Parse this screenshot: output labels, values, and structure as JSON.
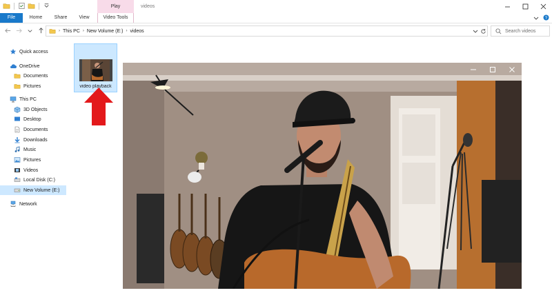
{
  "titlebar": {
    "context_tab": "Play",
    "window_title": "videos"
  },
  "ribbon": {
    "tabs": [
      "File",
      "Home",
      "Share",
      "View",
      "Video Tools"
    ]
  },
  "address": {
    "crumbs": [
      "This PC",
      "New Volume (E:)",
      "videos"
    ],
    "search_placeholder": "Search videos"
  },
  "navpane": {
    "items": [
      {
        "label": "Quick access",
        "icon": "star-icon"
      },
      {
        "label": "OneDrive",
        "icon": "cloud-icon"
      },
      {
        "label": "Documents",
        "icon": "folder-icon"
      },
      {
        "label": "Pictures",
        "icon": "folder-icon"
      },
      {
        "label": "This PC",
        "icon": "computer-icon"
      },
      {
        "label": "3D Objects",
        "icon": "cube-icon"
      },
      {
        "label": "Desktop",
        "icon": "desktop-icon"
      },
      {
        "label": "Documents",
        "icon": "documents-icon"
      },
      {
        "label": "Downloads",
        "icon": "download-icon"
      },
      {
        "label": "Music",
        "icon": "music-icon"
      },
      {
        "label": "Pictures",
        "icon": "pictures-icon"
      },
      {
        "label": "Videos",
        "icon": "videos-icon"
      },
      {
        "label": "Local Disk (C:)",
        "icon": "drive-icon"
      },
      {
        "label": "New Volume (E:)",
        "icon": "drive-icon",
        "selected": true
      },
      {
        "label": "Network",
        "icon": "network-icon"
      }
    ]
  },
  "content": {
    "file_label": "video playback"
  },
  "colors": {
    "accent": "#1979ca",
    "context_tab": "#f8dbe9",
    "selection": "#cde8ff",
    "arrow": "#e3191b"
  }
}
